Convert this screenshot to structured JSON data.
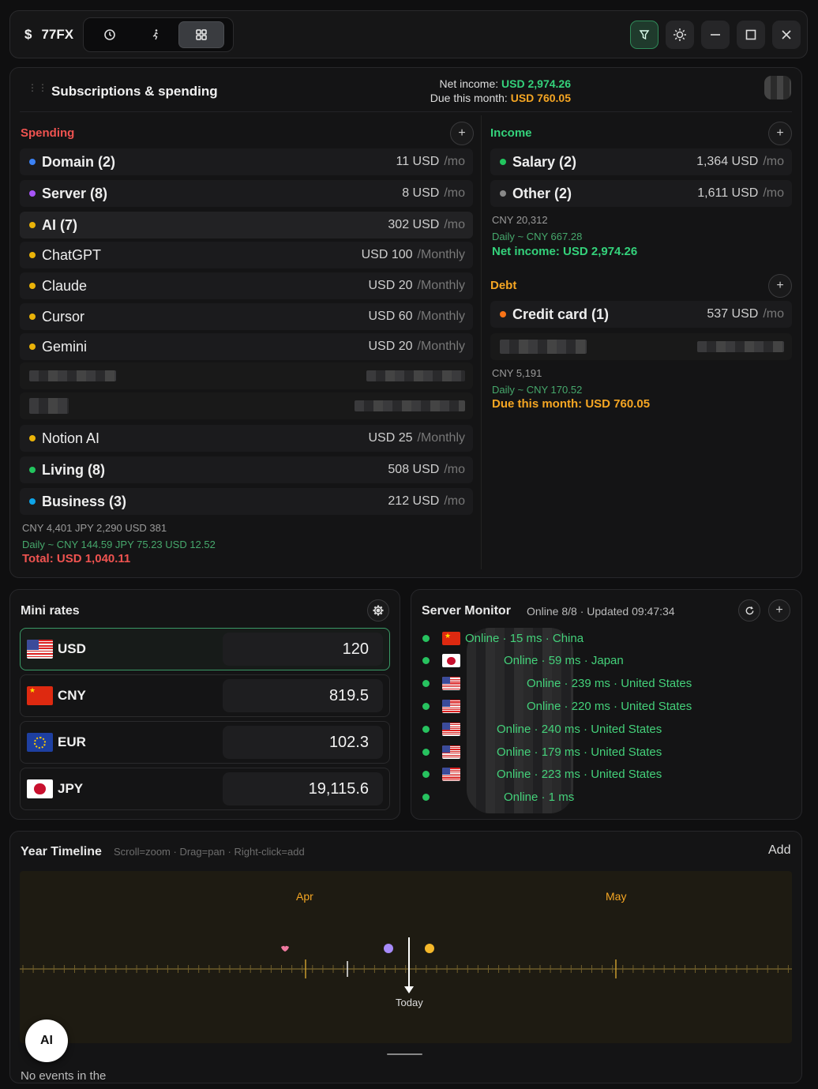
{
  "app": {
    "currency_symbol": "$",
    "name": "77FX"
  },
  "subs": {
    "title": "Subscriptions & spending",
    "net_label": "Net income:",
    "net_value": "USD 2,974.26",
    "due_label": "Due this month:",
    "due_value": "USD 760.05",
    "spending": {
      "title": "Spending",
      "rows": [
        {
          "label": "Domain (2)",
          "amount": "11 USD",
          "unit": "/mo",
          "color": "#3b82f6",
          "bold": true
        },
        {
          "label": "Server (8)",
          "amount": "8 USD",
          "unit": "/mo",
          "color": "#a855f7",
          "bold": true
        },
        {
          "label": "AI (7)",
          "amount": "302 USD",
          "unit": "/mo",
          "color": "#eab308",
          "bold": true
        },
        {
          "label": "ChatGPT",
          "amount": "USD 100",
          "unit": "/Monthly",
          "color": "#eab308",
          "bold": false
        },
        {
          "label": "Claude",
          "amount": "USD 20",
          "unit": "/Monthly",
          "color": "#eab308",
          "bold": false
        },
        {
          "label": "Cursor",
          "amount": "USD 60",
          "unit": "/Monthly",
          "color": "#eab308",
          "bold": false
        },
        {
          "label": "Gemini",
          "amount": "USD 20",
          "unit": "/Monthly",
          "color": "#eab308",
          "bold": false
        },
        {
          "label": "Notion AI",
          "amount": "USD 25",
          "unit": "/Monthly",
          "color": "#eab308",
          "bold": false
        },
        {
          "label": "Living (8)",
          "amount": "508 USD",
          "unit": "/mo",
          "color": "#22c55e",
          "bold": true
        },
        {
          "label": "Business (3)",
          "amount": "212 USD",
          "unit": "/mo",
          "color": "#0ea5e9",
          "bold": true
        }
      ],
      "totals": "CNY 4,401   JPY 2,290   USD 381",
      "daily": "Daily ~ CNY 144.59 JPY 75.23 USD 12.52",
      "total": "Total: USD 1,040.11"
    },
    "income": {
      "title": "Income",
      "rows": [
        {
          "label": "Salary (2)",
          "amount": "1,364 USD",
          "unit": "/mo",
          "color": "#22c55e"
        },
        {
          "label": "Other (2)",
          "amount": "1,611 USD",
          "unit": "/mo",
          "color": "#888888"
        }
      ],
      "totals": "CNY 20,312",
      "daily": "Daily ~ CNY 667.28",
      "net": "Net income: USD 2,974.26"
    },
    "debt": {
      "title": "Debt",
      "rows": [
        {
          "label": "Credit card (1)",
          "amount": "537 USD",
          "unit": "/mo",
          "color": "#f97316"
        }
      ],
      "totals": "CNY 5,191",
      "daily": "Daily ~ CNY 170.52",
      "due": "Due this month: USD 760.05"
    }
  },
  "mini": {
    "title": "Mini rates",
    "rates": [
      {
        "code": "USD",
        "value": "120"
      },
      {
        "code": "CNY",
        "value": "819.5"
      },
      {
        "code": "EUR",
        "value": "102.3"
      },
      {
        "code": "JPY",
        "value": "19,115.6"
      }
    ]
  },
  "server": {
    "title": "Server Monitor",
    "status": "Online 8/8 · Updated 09:47:34",
    "rows": [
      {
        "text": "Online · 15 ms · China",
        "flag": "cn"
      },
      {
        "text": "Online · 59 ms · Japan",
        "flag": "jp"
      },
      {
        "text": "Online · 239 ms · United States",
        "flag": "us"
      },
      {
        "text": "Online · 220 ms · United States",
        "flag": "us"
      },
      {
        "text": "Online · 240 ms · United States",
        "flag": "us"
      },
      {
        "text": "Online · 179 ms · United States",
        "flag": "us"
      },
      {
        "text": "Online · 223 ms · United States",
        "flag": "us"
      },
      {
        "text": "Online · 1 ms",
        "flag": ""
      }
    ]
  },
  "timeline": {
    "title": "Year Timeline",
    "hint": "Scroll=zoom · Drag=pan · Right-click=add",
    "add": "Add",
    "months": [
      "Apr",
      "May"
    ],
    "today": "Today",
    "empty": "No events in the"
  },
  "ai": {
    "label": "AI"
  }
}
